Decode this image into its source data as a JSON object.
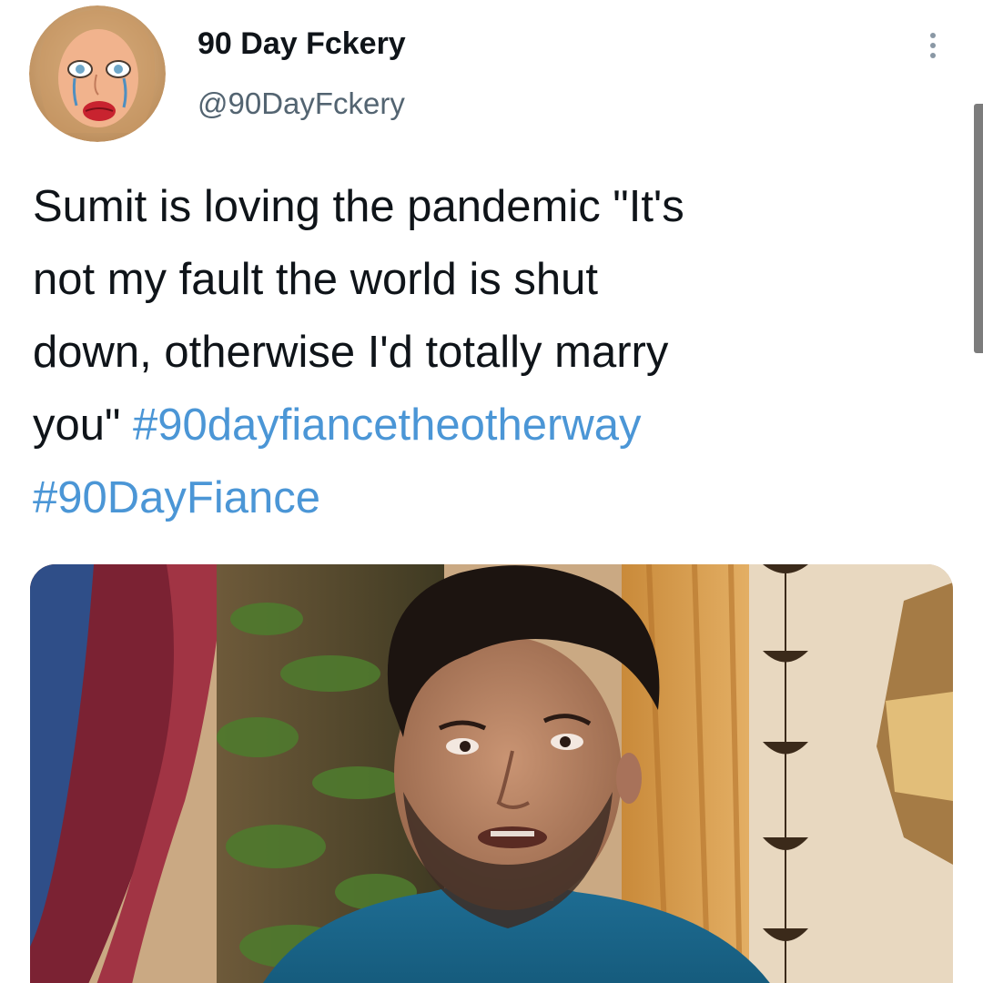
{
  "author": {
    "display_name": "90 Day Fckery",
    "handle": "@90DayFckery",
    "avatar_icon": "cartoon-crying-woman-avatar"
  },
  "menu": {
    "icon": "more-horizontal-icon"
  },
  "tweet": {
    "lines": [
      "Sumit is loving the pandemic \"It's",
      "not my fault the world is shut",
      "down, otherwise I'd totally marry",
      "you\" "
    ],
    "hashtags": [
      "#90dayfiancetheotherway",
      "#90DayFiance"
    ]
  },
  "media": {
    "icon": "photo-man-in-blue-kurta"
  },
  "colors": {
    "text": "#0f1419",
    "secondary_text": "#536471",
    "hashtag": "#4b96d6",
    "background": "#ffffff"
  }
}
